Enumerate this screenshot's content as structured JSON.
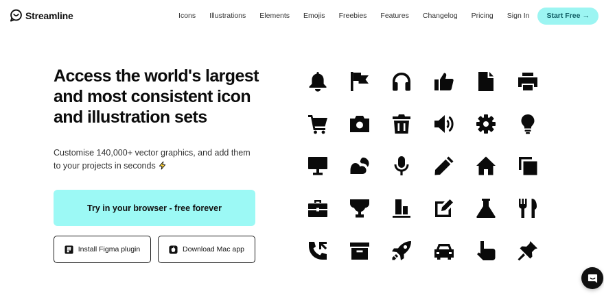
{
  "brand": {
    "name": "Streamline",
    "icon": "streamline-logo-icon"
  },
  "nav": {
    "links": [
      "Icons",
      "Illustrations",
      "Elements",
      "Emojis",
      "Freebies",
      "Features",
      "Changelog",
      "Pricing",
      "Sign In"
    ],
    "cta_label": "Start Free",
    "cta_arrow": "→"
  },
  "hero": {
    "headline": "Access the world's largest and most consistent icon and illustration sets",
    "subtitle": "Customise 140,000+ vector graphics, and add them to your projects in seconds",
    "subtitle_icon": "lightning-bolt-icon",
    "primary_cta": "Try in your browser - free forever",
    "secondary": [
      {
        "label": "Install Figma plugin",
        "icon": "figma-icon"
      },
      {
        "label": "Download Mac app",
        "icon": "apple-icon"
      }
    ]
  },
  "icon_grid": [
    [
      "bell-icon",
      "flag-icon",
      "headphones-icon",
      "thumbs-up-icon",
      "document-icon",
      "printer-icon"
    ],
    [
      "shopping-cart-icon",
      "camera-icon",
      "trash-icon",
      "speaker-icon",
      "gear-icon",
      "lightbulb-icon"
    ],
    [
      "monitor-icon",
      "cloud-sun-icon",
      "microphone-icon",
      "pencil-icon",
      "home-icon",
      "copy-icon"
    ],
    [
      "briefcase-icon",
      "trophy-icon",
      "bar-chart-icon",
      "edit-icon",
      "flask-icon",
      "cutlery-icon"
    ],
    [
      "phone-icon",
      "archive-icon",
      "rocket-icon",
      "car-icon",
      "hand-pointer-icon",
      "pin-icon"
    ]
  ],
  "chat": {
    "icon": "chat-bubble-icon"
  },
  "colors": {
    "accent": "#9cf9f5",
    "accent_text": "#0f5c63",
    "icon": "#0a0a0a",
    "text": "#111111"
  }
}
